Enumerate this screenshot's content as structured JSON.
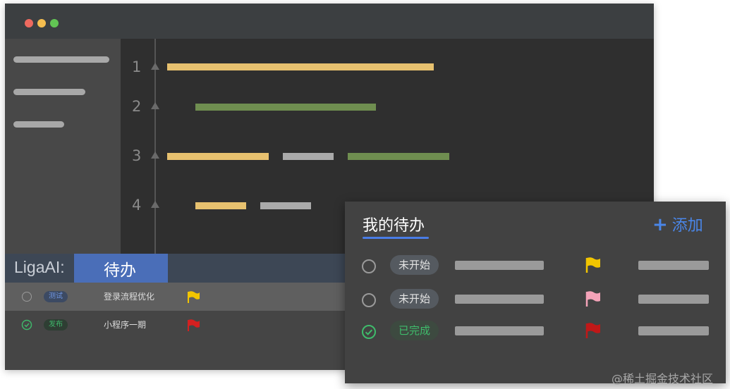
{
  "editor": {
    "line_numbers": [
      "1",
      "2",
      "3",
      "4"
    ]
  },
  "liga_panel": {
    "label": "LigaAI:",
    "tab_label": "待办",
    "tasks": [
      {
        "tag": "测试",
        "name": "登录流程优化",
        "flag_color": "#f2c500",
        "completed": false
      },
      {
        "tag": "发布",
        "name": "小程序一期",
        "flag_color": "#d42020",
        "completed": true
      }
    ]
  },
  "popup": {
    "title": "我的待办",
    "add_label": "添加",
    "items": [
      {
        "status": "未开始",
        "flag_color": "#f2c500",
        "completed": false
      },
      {
        "status": "未开始",
        "flag_color": "#f4a3b8",
        "completed": false
      },
      {
        "status": "已完成",
        "flag_color": "#c01818",
        "completed": true
      }
    ]
  },
  "colors": {
    "accent_blue": "#4a7de6",
    "done_green": "#3fbb6b",
    "code_yellow": "#e7c16f",
    "code_green": "#6f8e50",
    "code_gray": "#aaaaaa"
  },
  "watermark": "@稀土掘金技术社区"
}
